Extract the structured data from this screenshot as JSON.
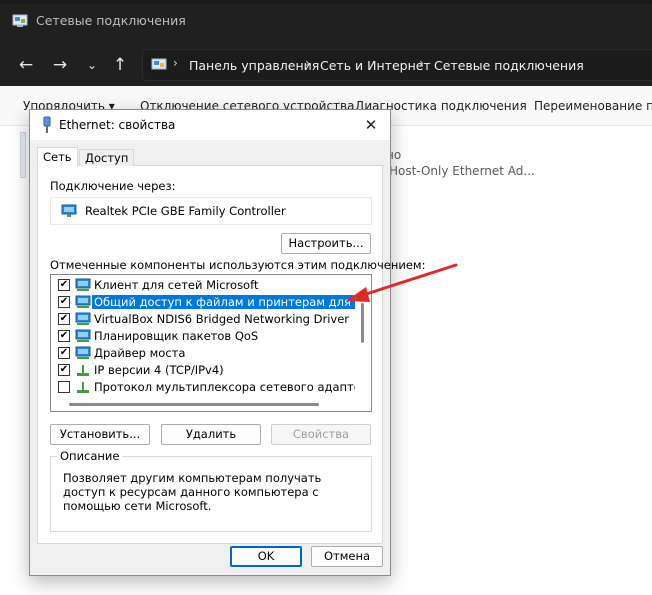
{
  "explorer": {
    "window_title": "Сетевые подключения",
    "breadcrumb": [
      "Панель управления",
      "Сеть и Интернет",
      "Сетевые подключения"
    ],
    "commands": [
      "Упорядочить ▾",
      "Отключение сетевого устройства",
      "Диагностика подключения",
      "Переименование под"
    ],
    "background_texts": [
      "но",
      "Host-Only Ethernet Ad..."
    ]
  },
  "dialog": {
    "title": "Ethernet: свойства",
    "close_glyph": "✕",
    "tabs": [
      {
        "label": "Сеть",
        "active": true
      },
      {
        "label": "Доступ",
        "active": false
      }
    ],
    "connect_using_label": "Подключение через:",
    "adapter_name": "Realtek PCIe GBE Family Controller",
    "configure_button": "Настроить...",
    "components_label": "Отмеченные компоненты используются этим подключением:",
    "components": [
      {
        "label": "Клиент для сетей Microsoft",
        "checked": true,
        "icon": "network-client-icon",
        "selected": false
      },
      {
        "label": "Общий доступ к файлам и принтерам для сетей M",
        "checked": true,
        "icon": "file-printer-sharing-icon",
        "selected": true
      },
      {
        "label": "VirtualBox NDIS6 Bridged Networking Driver",
        "checked": true,
        "icon": "network-service-icon",
        "selected": false
      },
      {
        "label": "Планировщик пакетов QoS",
        "checked": true,
        "icon": "network-service-icon",
        "selected": false
      },
      {
        "label": "Драйвер моста",
        "checked": true,
        "icon": "network-service-icon",
        "selected": false
      },
      {
        "label": "IP версии 4 (TCP/IPv4)",
        "checked": true,
        "icon": "protocol-icon",
        "selected": false
      },
      {
        "label": "Протокол мультиплексора сетевого адаптера (Ma",
        "checked": false,
        "icon": "protocol-icon",
        "selected": false
      }
    ],
    "install_button": "Установить...",
    "remove_button": "Удалить",
    "properties_button": "Свойства",
    "description_legend": "Описание",
    "description_text": "Позволяет другим компьютерам получать доступ к ресурсам данного компьютера с помощью сети Microsoft.",
    "ok_button": "OK",
    "cancel_button": "Отмена"
  },
  "colors": {
    "explorer_dark": "#202020",
    "selection": "#0078d7",
    "annotation_arrow": "#e02a2a"
  }
}
